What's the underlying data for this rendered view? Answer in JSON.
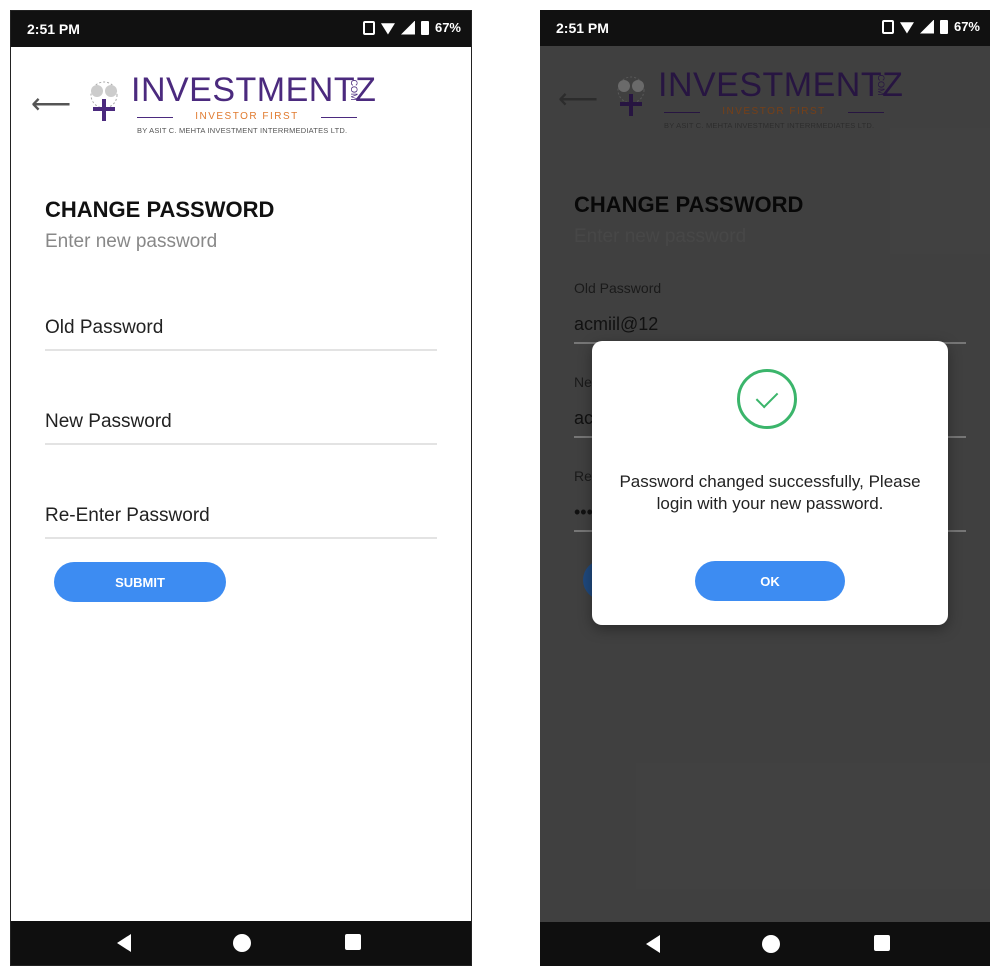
{
  "status_bar": {
    "time": "2:51 PM",
    "battery": "67%"
  },
  "brand": {
    "name": "INVESTMENTZ",
    "com": ".COM",
    "tagline": "INVESTOR FIRST",
    "sub": "BY ASIT C. MEHTA INVESTMENT INTERRMEDIATES LTD."
  },
  "form": {
    "title": "CHANGE PASSWORD",
    "subtitle": "Enter new password",
    "old_password_label": "Old Password",
    "new_password_label": "New Password",
    "reenter_password_label": "Re-Enter Password",
    "submit_label": "SUBMIT"
  },
  "filled_form": {
    "old_password_label": "Old Password",
    "old_password_value": "acmiil@12",
    "new_label_visible": "Ne",
    "new_value_visible": "ac",
    "reenter_label_visible": "Re",
    "reenter_value_visible": "•••"
  },
  "dialog": {
    "message": "Password changed successfully, Please login with your new password.",
    "ok_label": "OK"
  },
  "colors": {
    "accent": "#3d8cf2",
    "success": "#3bb56b",
    "brand_purple": "#4b2a7e",
    "brand_orange": "#e07a2e"
  },
  "icons": [
    "back-arrow-icon",
    "logo-tree-icon",
    "checkmark-icon",
    "nav-back-icon",
    "nav-home-icon",
    "nav-recent-icon"
  ]
}
